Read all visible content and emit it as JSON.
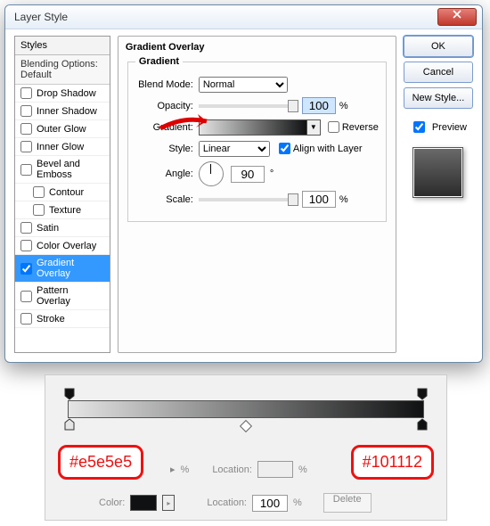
{
  "window": {
    "title": "Layer Style"
  },
  "styles": {
    "header": "Styles",
    "subheader": "Blending Options: Default",
    "items": [
      {
        "label": "Drop Shadow",
        "checked": false,
        "indent": false
      },
      {
        "label": "Inner Shadow",
        "checked": false,
        "indent": false
      },
      {
        "label": "Outer Glow",
        "checked": false,
        "indent": false
      },
      {
        "label": "Inner Glow",
        "checked": false,
        "indent": false
      },
      {
        "label": "Bevel and Emboss",
        "checked": false,
        "indent": false
      },
      {
        "label": "Contour",
        "checked": false,
        "indent": true
      },
      {
        "label": "Texture",
        "checked": false,
        "indent": true
      },
      {
        "label": "Satin",
        "checked": false,
        "indent": false
      },
      {
        "label": "Color Overlay",
        "checked": false,
        "indent": false
      },
      {
        "label": "Gradient Overlay",
        "checked": true,
        "indent": false,
        "selected": true
      },
      {
        "label": "Pattern Overlay",
        "checked": false,
        "indent": false
      },
      {
        "label": "Stroke",
        "checked": false,
        "indent": false
      }
    ]
  },
  "section": {
    "title": "Gradient Overlay",
    "group": "Gradient",
    "blend_mode_label": "Blend Mode:",
    "blend_mode_value": "Normal",
    "opacity_label": "Opacity:",
    "opacity_value": "100",
    "percent": "%",
    "gradient_label": "Gradient:",
    "reverse_label": "Reverse",
    "reverse_checked": false,
    "style_label": "Style:",
    "style_value": "Linear",
    "align_label": "Align with Layer",
    "align_checked": true,
    "angle_label": "Angle:",
    "angle_value": "90",
    "degree": "°",
    "scale_label": "Scale:",
    "scale_value": "100"
  },
  "buttons": {
    "ok": "OK",
    "cancel": "Cancel",
    "new_style": "New Style...",
    "preview_label": "Preview",
    "preview_checked": true
  },
  "editor": {
    "left_hex": "#e5e5e5",
    "right_hex": "#101112",
    "location_label": "Location:",
    "location_value": "100",
    "percent": "%",
    "color_label": "Color:",
    "delete": "Delete"
  }
}
